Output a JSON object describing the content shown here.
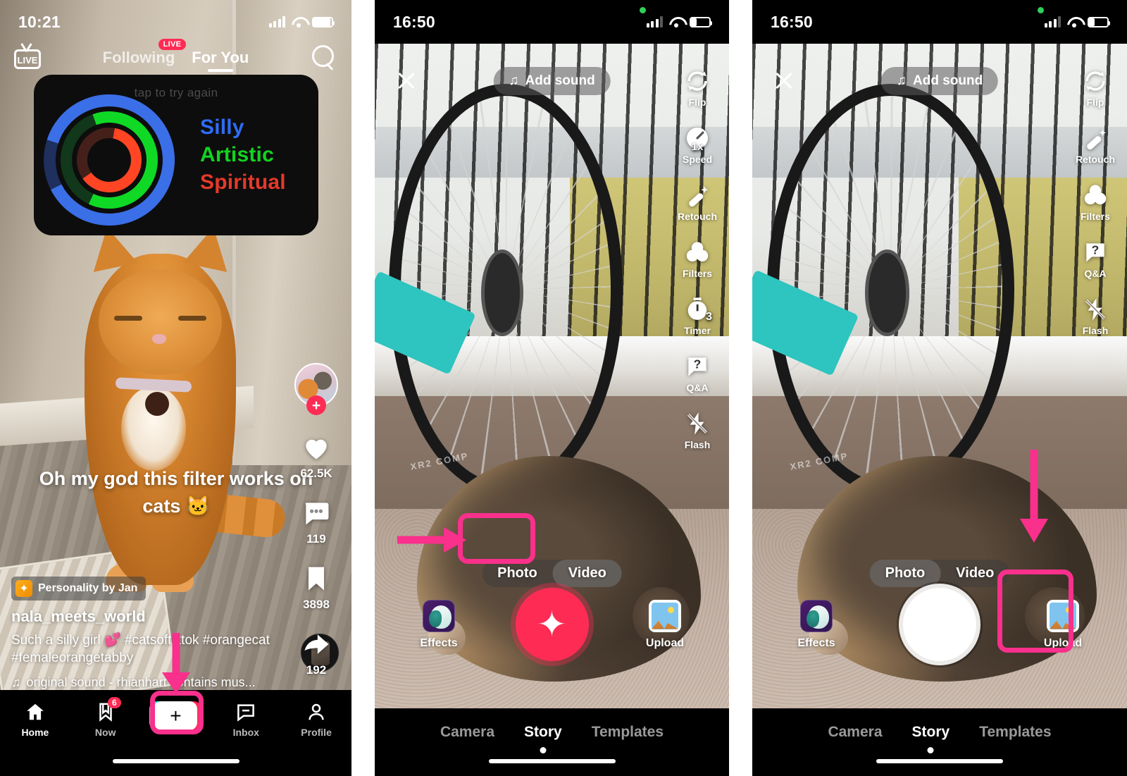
{
  "annotation": {
    "highlight_color": "#f9308c"
  },
  "panel1": {
    "name": "tiktok-feed",
    "status": {
      "time": "10:21"
    },
    "top_nav": {
      "live_label": "LIVE",
      "tabs": [
        {
          "label": "Following",
          "badge": "LIVE",
          "active": false
        },
        {
          "label": "For You",
          "active": true
        }
      ],
      "search_icon": "search-icon"
    },
    "filter_card": {
      "hint": "tap to try again",
      "results": [
        {
          "label": "Silly",
          "color": "#2d6df6",
          "ring": "outer"
        },
        {
          "label": "Artistic",
          "color": "#11d41f",
          "ring": "middle"
        },
        {
          "label": "Spiritual",
          "color": "#e5392a",
          "ring": "inner"
        }
      ]
    },
    "video_text": "Oh my god this filter works on cats 🐱",
    "rail": {
      "follow_label": "+",
      "likes": "62.5K",
      "comments": "119",
      "bookmarks": "3898",
      "shares": "192"
    },
    "caption": {
      "effect_chip": "Personality by Jan",
      "username": "nala_meets_world",
      "description": "Such a silly girl 💕 #catsoftiktok #orangecat #femaleorangetabby",
      "sound": "original sound - rhianhart  contains mus..."
    },
    "tabbar": [
      {
        "label": "Home",
        "icon": "home-icon",
        "active": true,
        "badge": ""
      },
      {
        "label": "Now",
        "icon": "now-icon",
        "active": false,
        "badge": "6"
      },
      {
        "label": "",
        "icon": "create-icon",
        "active": false,
        "badge": ""
      },
      {
        "label": "Inbox",
        "icon": "inbox-icon",
        "active": false,
        "badge": ""
      },
      {
        "label": "Profile",
        "icon": "profile-icon",
        "active": false,
        "badge": ""
      }
    ]
  },
  "panel2": {
    "name": "tiktok-story-camera-video",
    "status": {
      "time": "16:50"
    },
    "add_sound": "Add sound",
    "tools": [
      {
        "label": "Flip",
        "icon": "flip-icon"
      },
      {
        "label": "Speed",
        "icon": "speed-icon",
        "value": "1x"
      },
      {
        "label": "Retouch",
        "icon": "retouch-icon"
      },
      {
        "label": "Filters",
        "icon": "filters-icon"
      },
      {
        "label": "Timer",
        "icon": "timer-icon",
        "value": "3"
      },
      {
        "label": "Q&A",
        "icon": "qa-icon"
      },
      {
        "label": "Flash",
        "icon": "flash-off-icon"
      }
    ],
    "mode_toggle": {
      "options": [
        "Photo",
        "Video"
      ],
      "selected": "Video"
    },
    "effects_label": "Effects",
    "upload_label": "Upload",
    "watermark": "XR2 COMP",
    "tabs": [
      {
        "label": "Camera",
        "active": false
      },
      {
        "label": "Story",
        "active": true
      },
      {
        "label": "Templates",
        "active": false
      }
    ]
  },
  "panel3": {
    "name": "tiktok-story-camera-photo",
    "status": {
      "time": "16:50"
    },
    "add_sound": "Add sound",
    "tools": [
      {
        "label": "Flip",
        "icon": "flip-icon"
      },
      {
        "label": "Retouch",
        "icon": "retouch-icon"
      },
      {
        "label": "Filters",
        "icon": "filters-icon"
      },
      {
        "label": "Q&A",
        "icon": "qa-icon"
      },
      {
        "label": "Flash",
        "icon": "flash-off-icon"
      }
    ],
    "mode_toggle": {
      "options": [
        "Photo",
        "Video"
      ],
      "selected": "Photo"
    },
    "effects_label": "Effects",
    "upload_label": "Upload",
    "watermark": "XR2 COMP",
    "tabs": [
      {
        "label": "Camera",
        "active": false
      },
      {
        "label": "Story",
        "active": true
      },
      {
        "label": "Templates",
        "active": false
      }
    ]
  }
}
